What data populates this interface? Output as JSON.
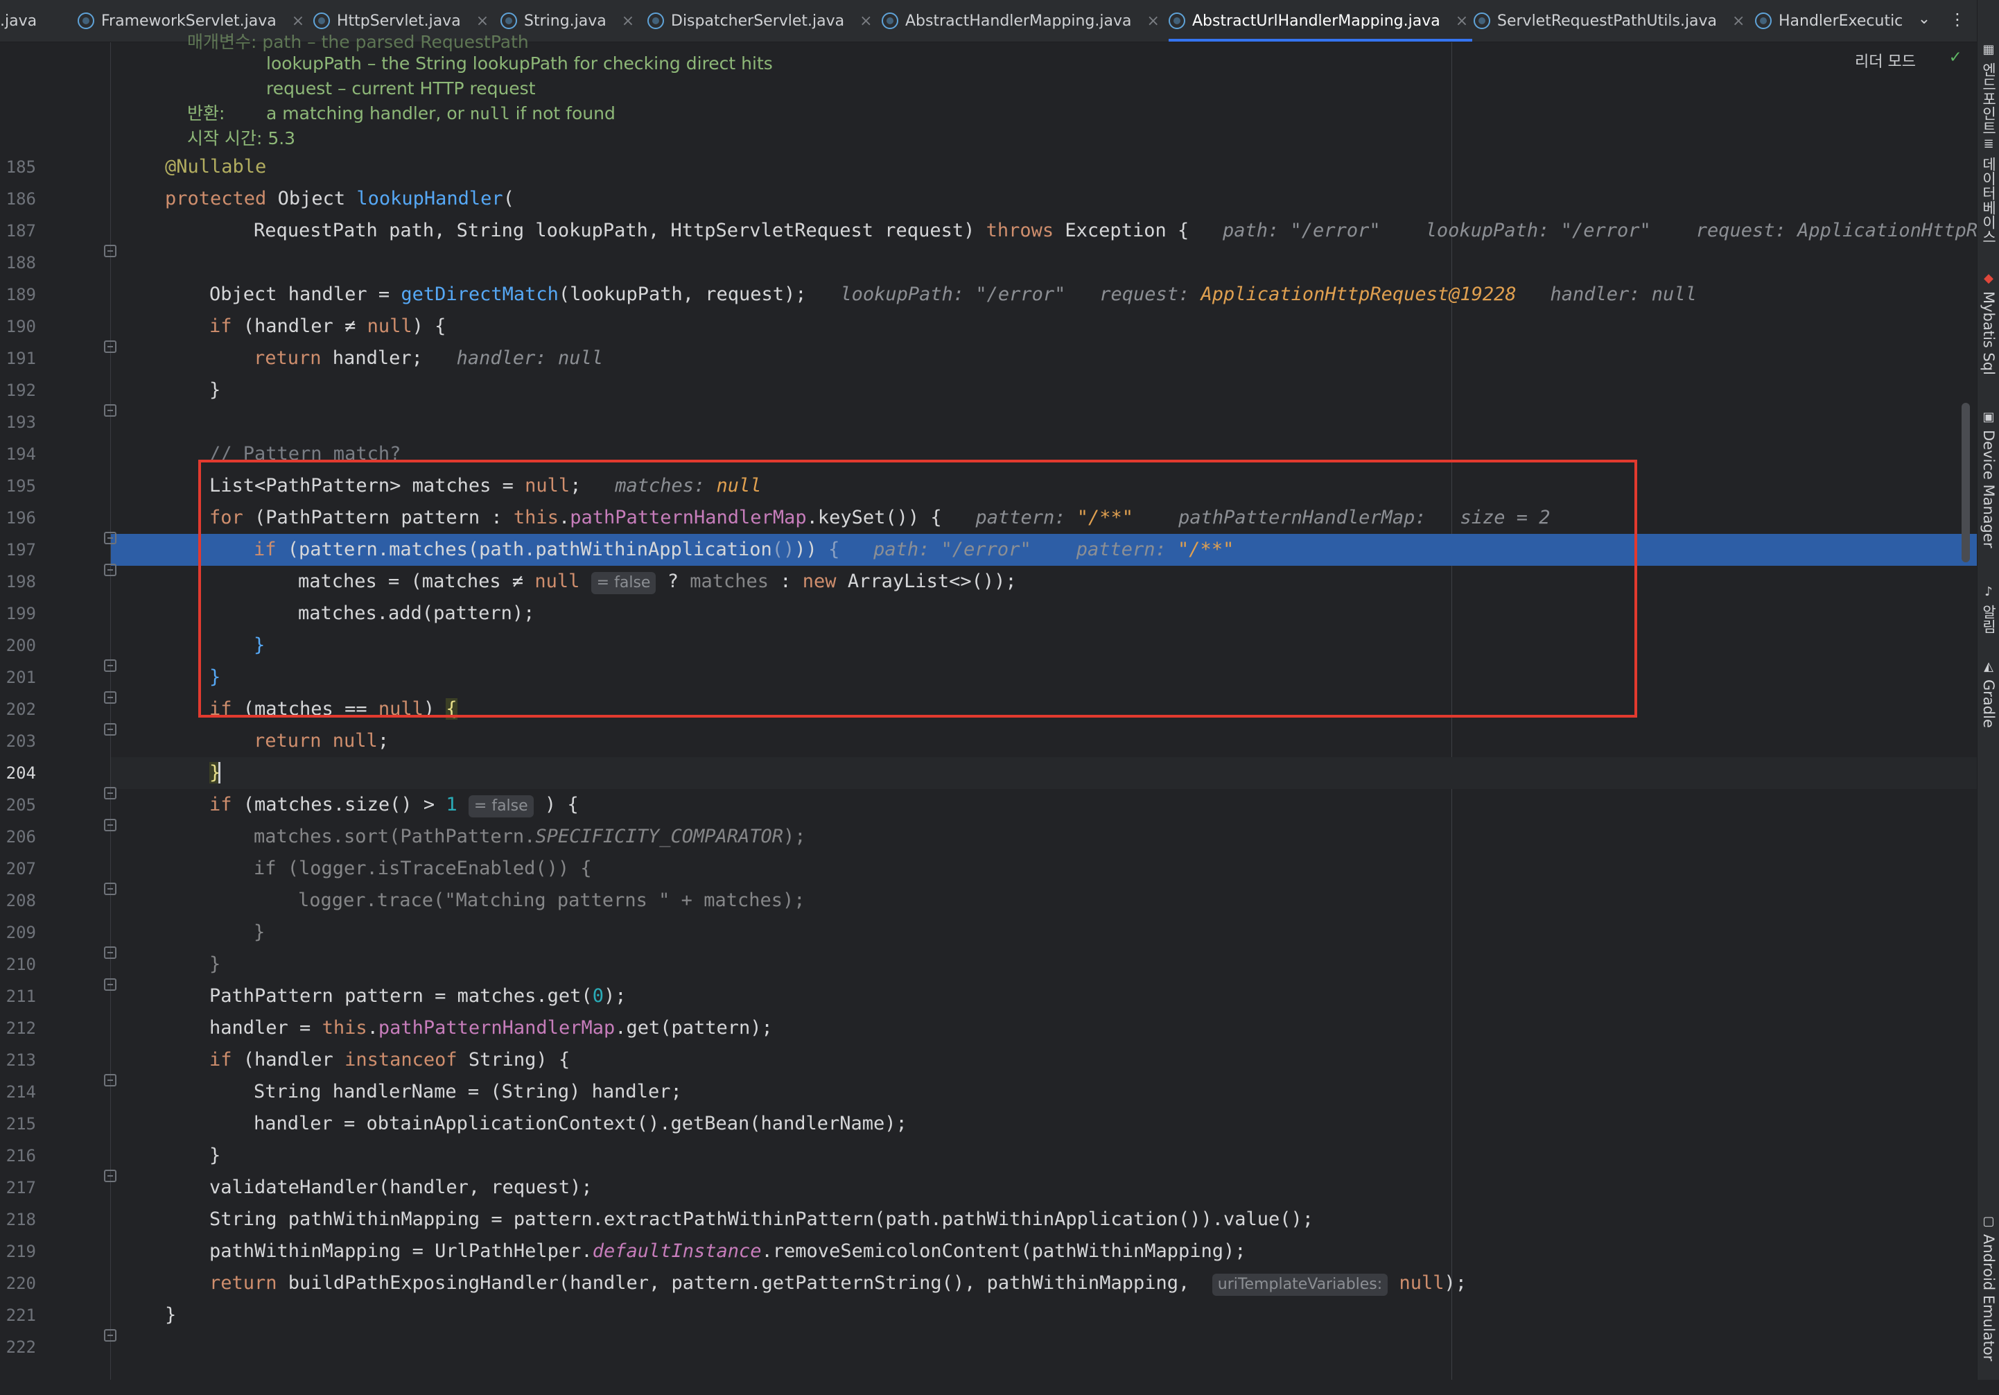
{
  "tabs": [
    {
      "label": ".java",
      "icon": false,
      "close": false,
      "active": false
    },
    {
      "label": "FrameworkServlet.java",
      "icon": true,
      "close": true,
      "active": false
    },
    {
      "label": "HttpServlet.java",
      "icon": true,
      "close": true,
      "active": false
    },
    {
      "label": "String.java",
      "icon": true,
      "close": true,
      "active": false
    },
    {
      "label": "DispatcherServlet.java",
      "icon": true,
      "close": true,
      "active": false
    },
    {
      "label": "AbstractHandlerMapping.java",
      "icon": true,
      "close": true,
      "active": false
    },
    {
      "label": "AbstractUrlHandlerMapping.java",
      "icon": true,
      "close": true,
      "active": true
    },
    {
      "label": "ServletRequestPathUtils.java",
      "icon": true,
      "close": true,
      "active": false
    },
    {
      "label": "HandlerExecutic",
      "icon": true,
      "close": false,
      "active": false
    }
  ],
  "tab_close_glyph": "×",
  "editor": {
    "reader_mode_label": "리더 모드"
  },
  "javadoc": {
    "param_line_label": "매개변수: path – the parsed RequestPath",
    "param_lookup": "lookupPath – the String lookupPath for checking direct hits",
    "param_request": "request – current HTTP request",
    "returns_label": "반환:",
    "returns_text_a": "a matching handler, or",
    "returns_code": "null",
    "returns_text_b": "if not found",
    "since_label": "시작 시간:",
    "since_value": "5.3"
  },
  "line_numbers": [
    "185",
    "186",
    "187",
    "188",
    "189",
    "190",
    "191",
    "192",
    "193",
    "194",
    "195",
    "196",
    "197",
    "198",
    "199",
    "200",
    "201",
    "202",
    "203",
    "204",
    "205",
    "206",
    "207",
    "208",
    "209",
    "210",
    "211",
    "212",
    "213",
    "214",
    "215",
    "216",
    "217",
    "218",
    "219",
    "220",
    "221",
    "222"
  ],
  "current_line": "204",
  "highlight_line": "197",
  "hints": {
    "l187_path_k": "path:",
    "l187_path_v": "\"/error\"",
    "l187_lookup_k": "lookupPath:",
    "l187_lookup_v": "\"/error\"",
    "l187_req_k": "request:",
    "l187_req_v": "ApplicationHttpReq",
    "l189_lookup_k": "lookupPath:",
    "l189_lookup_v": "\"/error\"",
    "l189_req_k": "request:",
    "l189_req_v": "ApplicationHttpRequest@19228",
    "l189_handler_k": "handler:",
    "l189_handler_v": "null",
    "l191_handler_k": "handler:",
    "l191_handler_v": "null",
    "l195_matches_k": "matches:",
    "l195_matches_v": "null",
    "l196_pattern_k": "pattern:",
    "l196_pattern_v": "\"/**\"",
    "l196_map_k": "pathPatternHandlerMap:",
    "l196_map_v": "size = 2",
    "l197_path_k": "path:",
    "l197_path_v": "\"/error\"",
    "l197_pattern_k": "pattern:",
    "l197_pattern_v": "\"/**\"",
    "l198_inline": "= false",
    "l205_inline": "= false",
    "l220_inline": "uriTemplateVariables:"
  },
  "right_strip": [
    {
      "label": "엔드포인트",
      "icon": "endpoints-icon",
      "glyph": "▦"
    },
    {
      "label": "데이터베이스",
      "icon": "database-icon",
      "glyph": "≣"
    },
    {
      "label": "Mybatis Sql",
      "icon": "mybatis-icon",
      "glyph": "◆"
    },
    {
      "label": "Device Manager",
      "icon": "device-manager-icon",
      "glyph": "▣"
    },
    {
      "label": "알림",
      "icon": "bell-icon",
      "glyph": "♪"
    },
    {
      "label": "Gradle",
      "icon": "gradle-icon",
      "glyph": "◭"
    },
    {
      "label": "Android Emulator",
      "icon": "emulator-icon",
      "glyph": "▢"
    }
  ],
  "colors": {
    "highlight": "#2d5ea6",
    "selection_box": "#e23a2f",
    "keyword": "#cf8e6d",
    "method": "#56a8f5",
    "field": "#c77dbb"
  }
}
